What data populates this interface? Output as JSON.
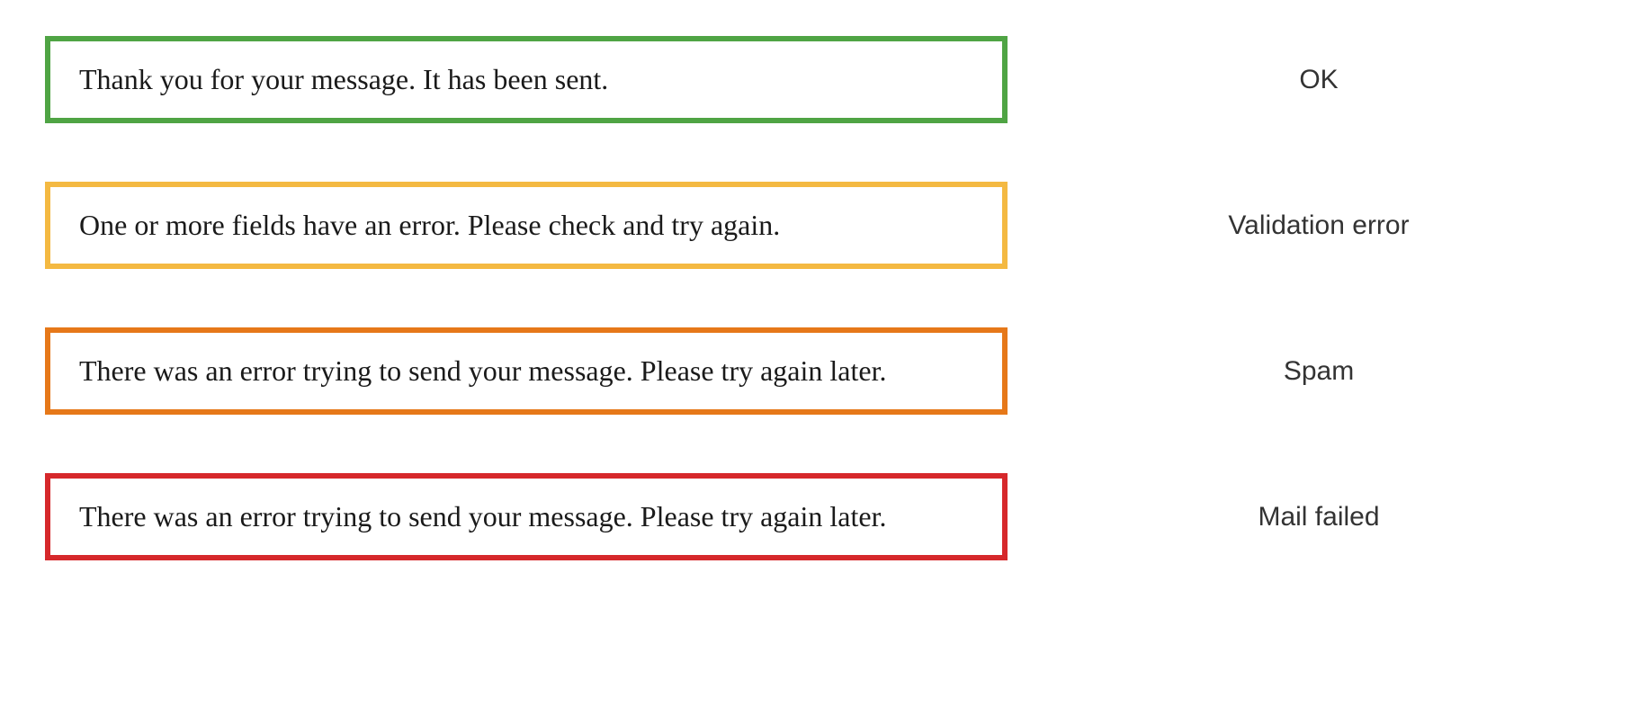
{
  "messages": [
    {
      "text": "Thank you for your message. It has been sent.",
      "label": "OK",
      "borderClass": "border-ok",
      "borderColor": "#4fa444"
    },
    {
      "text": "One or more fields have an error. Please check and try again.",
      "label": "Validation error",
      "borderClass": "border-validation",
      "borderColor": "#f4b942"
    },
    {
      "text": "There was an error trying to send your message. Please try again later.",
      "label": "Spam",
      "borderClass": "border-spam",
      "borderColor": "#e67819"
    },
    {
      "text": "There was an error trying to send your message. Please try again later.",
      "label": "Mail failed",
      "borderClass": "border-failed",
      "borderColor": "#d6282b"
    }
  ]
}
